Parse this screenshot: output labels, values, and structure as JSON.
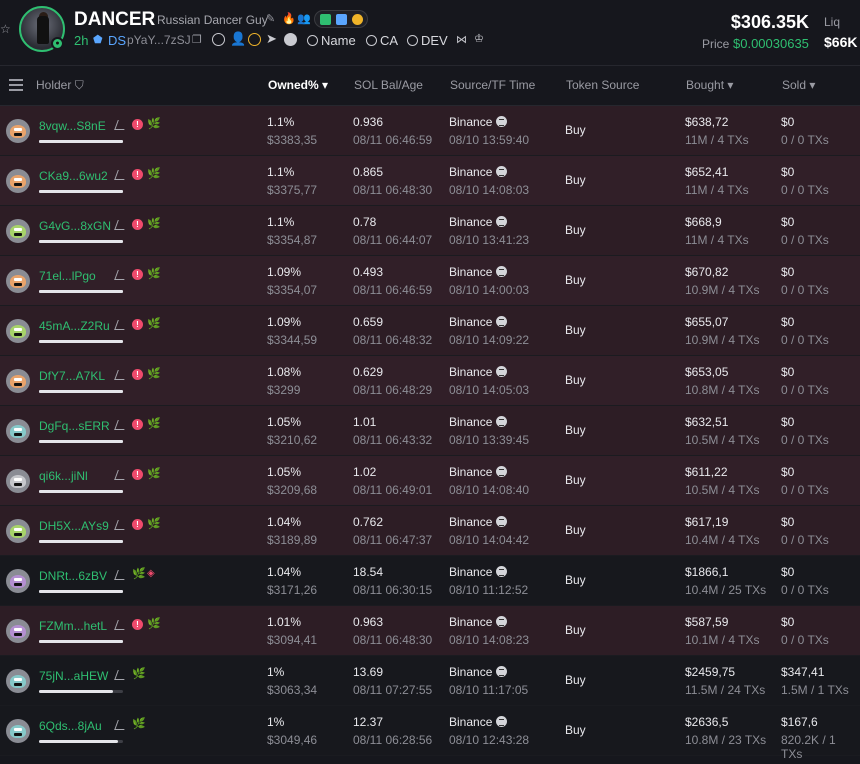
{
  "token": {
    "symbol": "DANCER",
    "name": "Russian Dancer Guy",
    "age": "2h",
    "ds_label": "DS",
    "address": "pYaY...7zSJ",
    "search_name": "Name",
    "search_ca": "CA",
    "search_dev": "DEV",
    "market_cap": "$306.35K",
    "liq_label": "Liq",
    "price_label": "Price",
    "price": "$0.00030635",
    "liquidity": "$66K"
  },
  "columns": {
    "holder": "Holder",
    "owned": "Owned%",
    "sol_bal": "SOL Bal/Age",
    "source_tf": "Source/TF Time",
    "token_source": "Token Source",
    "bought": "Bought",
    "sold": "Sold"
  },
  "colors": {
    "accent_green": "#2fbf71",
    "row_red": "#2d1d25",
    "row_dark": "#17181d"
  },
  "rows": [
    {
      "holder": "8vqw...S8nE",
      "pfp": "#e9a36b",
      "flag": "alert",
      "owned": "1.1%",
      "owned_usd": "$3383,35",
      "sol": "0.936",
      "age": "08/11 06:46:59",
      "source": "Binance",
      "source_time": "08/10 13:59:40",
      "token_source": "Buy",
      "bought": "$638,72",
      "bought_sub": "11M / 4 TXs",
      "sold": "$0",
      "sold_sub": "0 / 0 TXs",
      "bar": 1.0,
      "style": "odd"
    },
    {
      "holder": "CKa9...6wu2",
      "pfp": "#e9a36b",
      "flag": "alert",
      "owned": "1.1%",
      "owned_usd": "$3375,77",
      "sol": "0.865",
      "age": "08/11 06:48:30",
      "source": "Binance",
      "source_time": "08/10 14:08:03",
      "token_source": "Buy",
      "bought": "$652,41",
      "bought_sub": "11M / 4 TXs",
      "sold": "$0",
      "sold_sub": "0 / 0 TXs",
      "bar": 1.0,
      "style": "even"
    },
    {
      "holder": "G4vG...8xGN",
      "pfp": "#a7d36a",
      "flag": "alert",
      "owned": "1.1%",
      "owned_usd": "$3354,87",
      "sol": "0.78",
      "age": "08/11 06:44:07",
      "source": "Binance",
      "source_time": "08/10 13:41:23",
      "token_source": "Buy",
      "bought": "$668,9",
      "bought_sub": "11M / 4 TXs",
      "sold": "$0",
      "sold_sub": "0 / 0 TXs",
      "bar": 1.0,
      "style": "odd"
    },
    {
      "holder": "71el...lPgo",
      "pfp": "#e9a36b",
      "flag": "alert",
      "owned": "1.09%",
      "owned_usd": "$3354,07",
      "sol": "0.493",
      "age": "08/11 06:46:59",
      "source": "Binance",
      "source_time": "08/10 14:00:03",
      "token_source": "Buy",
      "bought": "$670,82",
      "bought_sub": "10.9M / 4 TXs",
      "sold": "$0",
      "sold_sub": "0 / 0 TXs",
      "bar": 1.0,
      "style": "even"
    },
    {
      "holder": "45mA...Z2Ru",
      "pfp": "#a7d36a",
      "flag": "alert",
      "owned": "1.09%",
      "owned_usd": "$3344,59",
      "sol": "0.659",
      "age": "08/11 06:48:32",
      "source": "Binance",
      "source_time": "08/10 14:09:22",
      "token_source": "Buy",
      "bought": "$655,07",
      "bought_sub": "10.9M / 4 TXs",
      "sold": "$0",
      "sold_sub": "0 / 0 TXs",
      "bar": 1.0,
      "style": "odd"
    },
    {
      "holder": "DfY7...A7KL",
      "pfp": "#e9a36b",
      "flag": "alert",
      "owned": "1.08%",
      "owned_usd": "$3299",
      "sol": "0.629",
      "age": "08/11 06:48:29",
      "source": "Binance",
      "source_time": "08/10 14:05:03",
      "token_source": "Buy",
      "bought": "$653,05",
      "bought_sub": "10.8M / 4 TXs",
      "sold": "$0",
      "sold_sub": "0 / 0 TXs",
      "bar": 1.0,
      "style": "even"
    },
    {
      "holder": "DgFq...sERR",
      "pfp": "#86c9c9",
      "flag": "alert",
      "owned": "1.05%",
      "owned_usd": "$3210,62",
      "sol": "1.01",
      "age": "08/11 06:43:32",
      "source": "Binance",
      "source_time": "08/10 13:39:45",
      "token_source": "Buy",
      "bought": "$632,51",
      "bought_sub": "10.5M / 4 TXs",
      "sold": "$0",
      "sold_sub": "0 / 0 TXs",
      "bar": 1.0,
      "style": "odd"
    },
    {
      "holder": "qi6k...jiNl",
      "pfp": "#c6c7cc",
      "flag": "alert",
      "owned": "1.05%",
      "owned_usd": "$3209,68",
      "sol": "1.02",
      "age": "08/11 06:49:01",
      "source": "Binance",
      "source_time": "08/10 14:08:40",
      "token_source": "Buy",
      "bought": "$611,22",
      "bought_sub": "10.5M / 4 TXs",
      "sold": "$0",
      "sold_sub": "0 / 0 TXs",
      "bar": 1.0,
      "style": "even"
    },
    {
      "holder": "DH5X...AYs9",
      "pfp": "#a7d36a",
      "flag": "alert",
      "owned": "1.04%",
      "owned_usd": "$3189,89",
      "sol": "0.762",
      "age": "08/11 06:47:37",
      "source": "Binance",
      "source_time": "08/10 14:04:42",
      "token_source": "Buy",
      "bought": "$617,19",
      "bought_sub": "10.4M / 4 TXs",
      "sold": "$0",
      "sold_sub": "0 / 0 TXs",
      "bar": 1.0,
      "style": "odd"
    },
    {
      "holder": "DNRt...6zBV",
      "pfp": "#b48fd1",
      "flag": "stack",
      "owned": "1.04%",
      "owned_usd": "$3171,26",
      "sol": "18.54",
      "age": "08/11 06:30:15",
      "source": "Binance",
      "source_time": "08/10 11:12:52",
      "token_source": "Buy",
      "bought": "$1866,1",
      "bought_sub": "10.4M / 25 TXs",
      "sold": "$0",
      "sold_sub": "0 / 0 TXs",
      "bar": 1.0,
      "style": "dark"
    },
    {
      "holder": "FZMm...hetL",
      "pfp": "#b48fd1",
      "flag": "alert",
      "owned": "1.01%",
      "owned_usd": "$3094,41",
      "sol": "0.963",
      "age": "08/11 06:48:30",
      "source": "Binance",
      "source_time": "08/10 14:08:23",
      "token_source": "Buy",
      "bought": "$587,59",
      "bought_sub": "10.1M / 4 TXs",
      "sold": "$0",
      "sold_sub": "0 / 0 TXs",
      "bar": 1.0,
      "style": "odd"
    },
    {
      "holder": "75jN...aHEW",
      "pfp": "#86c9c9",
      "flag": "none",
      "owned": "1%",
      "owned_usd": "$3063,34",
      "sol": "13.69",
      "age": "08/11 07:27:55",
      "source": "Binance",
      "source_time": "08/10 11:17:05",
      "token_source": "Buy",
      "bought": "$2459,75",
      "bought_sub": "11.5M / 24 TXs",
      "sold": "$347,41",
      "sold_sub": "1.5M / 1 TXs",
      "bar": 0.88,
      "style": "dark"
    },
    {
      "holder": "6Qds...8jAu",
      "pfp": "#86c9c9",
      "flag": "none",
      "owned": "1%",
      "owned_usd": "$3049,46",
      "sol": "12.37",
      "age": "08/11 06:28:56",
      "source": "Binance",
      "source_time": "08/10 12:43:28",
      "token_source": "Buy",
      "bought": "$2636,5",
      "bought_sub": "10.8M / 23 TXs",
      "sold": "$167,6",
      "sold_sub": "820.2K / 1 TXs",
      "bar": 0.94,
      "style": "dark"
    }
  ]
}
